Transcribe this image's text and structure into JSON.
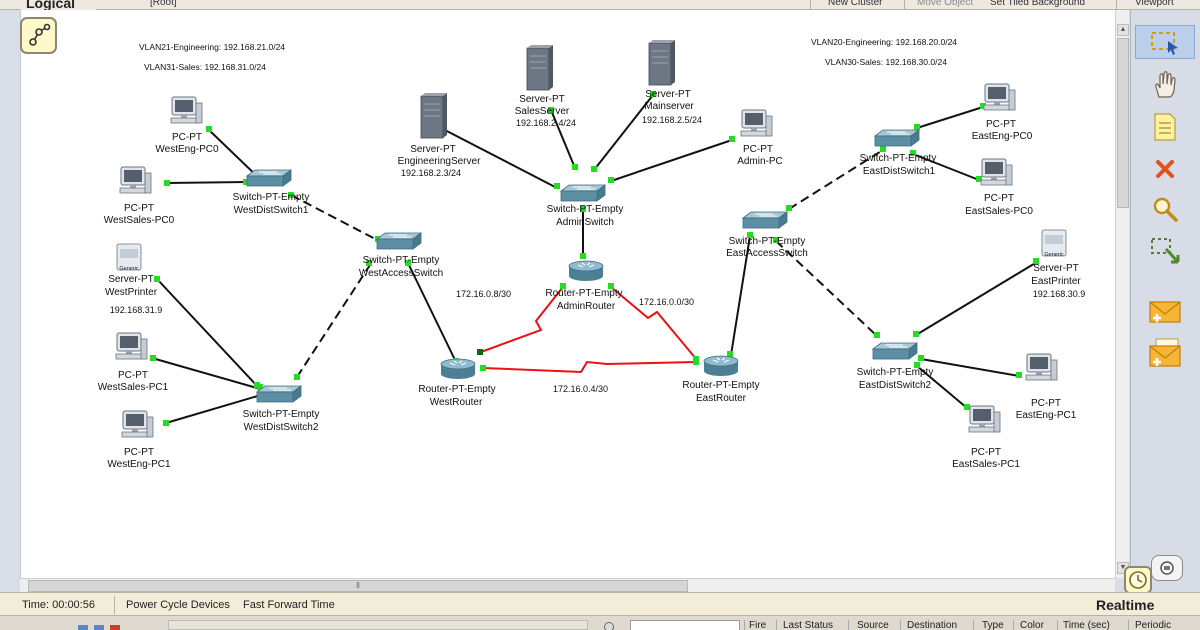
{
  "toolbar": {
    "logical_label": "Logical",
    "root_label": "[Root]",
    "new_cluster": "New Cluster",
    "move_object": "Move Object",
    "set_tiled_background": "Set Tiled Background",
    "viewport": "Viewport"
  },
  "annotations": {
    "west_vlan21": "VLAN21-Engineering: 192.168.21.0/24",
    "west_vlan31": "VLAN31-Sales: 192.168.31.0/24",
    "east_vlan20": "VLAN20-Engineering: 192.168.20.0/24",
    "east_vlan30": "VLAN30-Sales: 192.168.30.0/24"
  },
  "devices": {
    "westeng_pc0": {
      "type": "PC-PT",
      "name": "WestEng-PC0"
    },
    "westsales_pc0": {
      "type": "PC-PT",
      "name": "WestSales-PC0"
    },
    "westdistswitch1": {
      "type": "Switch-PT-Empty",
      "name": "WestDistSwitch1"
    },
    "westprinter": {
      "type": "Server-PT",
      "name": "WestPrinter",
      "ip": "192.168.31.9",
      "badge": "Generic"
    },
    "westsales_pc1": {
      "type": "PC-PT",
      "name": "WestSales-PC1"
    },
    "westeng_pc1": {
      "type": "PC-PT",
      "name": "WestEng-PC1"
    },
    "westdistswitch2": {
      "type": "Switch-PT-Empty",
      "name": "WestDistSwitch2"
    },
    "westaccessswitch": {
      "type": "Switch-PT-Empty",
      "name": "WestAccessSwitch"
    },
    "engineeringserver": {
      "type": "Server-PT",
      "name": "EngineeringServer",
      "ip": "192.168.2.3/24"
    },
    "salesserver": {
      "type": "Server-PT",
      "name": "SalesServer",
      "ip": "192.168.2.4/24"
    },
    "mainserver": {
      "type": "Server-PT",
      "name": "Mainserver",
      "ip": "192.168.2.5/24"
    },
    "admin_pc": {
      "type": "PC-PT",
      "name": "Admin-PC"
    },
    "adminswitch": {
      "type": "Switch-PT-Empty",
      "name": "AdminSwitch"
    },
    "adminrouter": {
      "type": "Router-PT-Empty",
      "name": "AdminRouter"
    },
    "westrouter": {
      "type": "Router-PT-Empty",
      "name": "WestRouter"
    },
    "eastrouter": {
      "type": "Router-PT-Empty",
      "name": "EastRouter"
    },
    "eastaccessswitch": {
      "type": "Switch-PT-Empty",
      "name": "EastAccessSwitch"
    },
    "eastdistswitch1": {
      "type": "Switch-PT-Empty",
      "name": "EastDistSwitch1"
    },
    "eastdistswitch2": {
      "type": "Switch-PT-Empty",
      "name": "EastDistSwitch2"
    },
    "easteng_pc0": {
      "type": "PC-PT",
      "name": "EastEng-PC0"
    },
    "eastsales_pc0": {
      "type": "PC-PT",
      "name": "EastSales-PC0"
    },
    "eastprinter": {
      "type": "Server-PT",
      "name": "EastPrinter",
      "ip": "192.168.30.9",
      "badge": "Generic"
    },
    "easteng_pc1": {
      "type": "PC-PT",
      "name": "EastEng-PC1"
    },
    "eastsales_pc1": {
      "type": "PC-PT",
      "name": "EastSales-PC1"
    }
  },
  "link_labels": {
    "west_admin": "172.16.0.8/30",
    "admin_east": "172.16.0.0/30",
    "west_east": "172.16.0.4/30"
  },
  "statusbar": {
    "time": "Time: 00:00:56",
    "power_cycle": "Power Cycle Devices",
    "fast_forward": "Fast Forward Time",
    "mode": "Realtime"
  },
  "event_list_columns": [
    "Fire",
    "Last Status",
    "Source",
    "Destination",
    "Type",
    "Color",
    "Time (sec)",
    "Periodic"
  ],
  "tools": [
    "select-icon",
    "hand-icon",
    "note-icon",
    "delete-icon",
    "zoom-icon",
    "resize-icon",
    "add-simple-pdu-icon",
    "add-complex-pdu-icon"
  ],
  "colors": {
    "link_up": "#22dd22",
    "serial_link": "#ee1111",
    "panel_bg": "#d7dce6",
    "status_bg": "#f1edd9"
  }
}
